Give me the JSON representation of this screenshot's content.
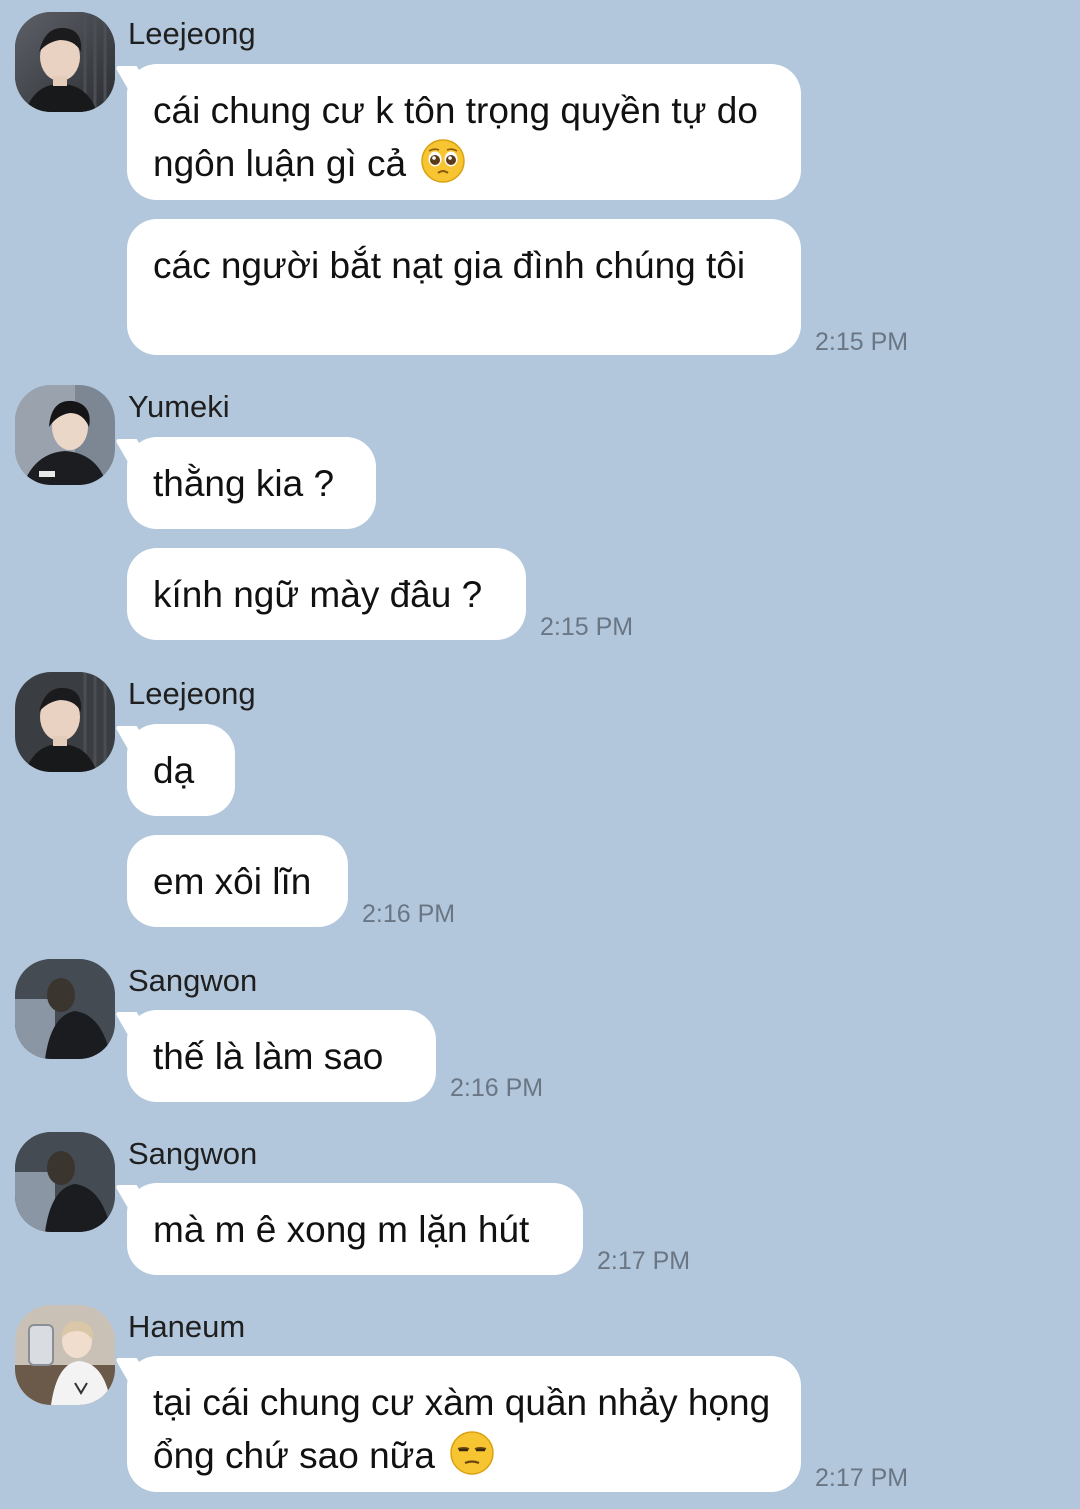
{
  "messages": [
    {
      "sender": "Leejeong",
      "avatar_icon": "leejeong-avatar",
      "bubbles": [
        "cái chung cư k tôn trọng quyền tự do ngôn luận gì cả",
        "các người bắt nạt gia đình chúng tôi"
      ],
      "emoji_after_first": "pleading-face-emoji",
      "time": "2:15 PM"
    },
    {
      "sender": "Yumeki",
      "avatar_icon": "yumeki-avatar",
      "bubbles": [
        "thằng kia ?",
        "kính ngữ mày đâu ?"
      ],
      "time": "2:15 PM"
    },
    {
      "sender": "Leejeong",
      "avatar_icon": "leejeong-avatar",
      "bubbles": [
        "dạ",
        "em xôi lĩn"
      ],
      "time": "2:16 PM"
    },
    {
      "sender": "Sangwon",
      "avatar_icon": "sangwon-avatar",
      "bubbles": [
        "thế là làm sao"
      ],
      "time": "2:16 PM"
    },
    {
      "sender": "Sangwon",
      "avatar_icon": "sangwon-avatar",
      "bubbles": [
        "mà m ê xong m lặn hút"
      ],
      "time": "2:17 PM"
    },
    {
      "sender": "Haneum",
      "avatar_icon": "haneum-avatar",
      "bubbles": [
        "tại cái chung cư xàm quần nhảy họng ổng chứ sao nữa"
      ],
      "emoji_after_last": "unamused-face-emoji",
      "time": "2:17 PM"
    }
  ],
  "colors": {
    "background": "#b3c7dc",
    "bubble": "#ffffff",
    "timestamp": "#6a7684"
  }
}
